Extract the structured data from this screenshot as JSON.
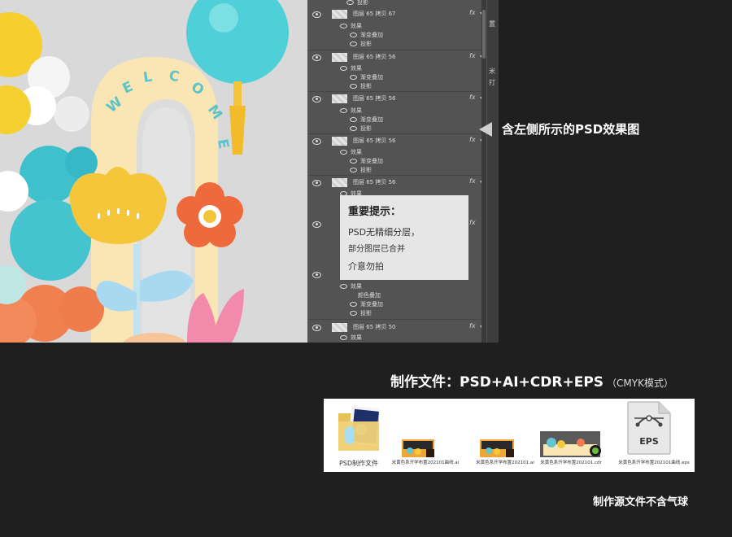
{
  "panel": {
    "layers": [
      {
        "name": "图层 65 拷贝 67",
        "fx": "fx",
        "effects": [
          "效果",
          "渐变叠加",
          "投影"
        ]
      },
      {
        "name": "图层 65 拷贝 56",
        "fx": "fx",
        "effects": [
          "效果",
          "渐变叠加",
          "投影"
        ]
      },
      {
        "name": "图层 65 拷贝 56",
        "fx": "fx",
        "effects": [
          "效果",
          "渐变叠加",
          "投影"
        ]
      },
      {
        "name": "图层 65 拷贝 56",
        "fx": "fx",
        "effects": [
          "效果",
          "渐变叠加",
          "投影"
        ]
      },
      {
        "name": "图层 65 拷贝 56",
        "fx": "fx",
        "effects": [
          "效果"
        ]
      }
    ],
    "lower_effects": [
      "效果",
      "颜色叠加",
      "渐变叠加",
      "投影"
    ],
    "last_layer": {
      "name": "图层 65 拷贝 50",
      "fx": "fx",
      "effects": [
        "效果"
      ]
    },
    "top_partial": "投影",
    "right_strip": [
      "置",
      "米",
      "打"
    ]
  },
  "notice": {
    "title": "重要提示：",
    "line1": "PSD无精细分层，",
    "line2": "部分图层已合并",
    "line3": "介意勿拍"
  },
  "callout": "含左侧所示的PSD效果图",
  "files_heading": "制作文件：PSD+AI+CDR+EPS",
  "files_heading_sub": "（CMYK模式）",
  "files": [
    {
      "label": "PSD制作文件",
      "icon": "folder-icon"
    },
    {
      "label": "米黄色系开学布置202101曲线.ai",
      "icon": "ai-file-icon"
    },
    {
      "label": "米黄色系开学布置202101.ai",
      "icon": "ai-file-icon"
    },
    {
      "label": "米黄色系开学布置202101.cdr",
      "icon": "cdr-file-icon"
    },
    {
      "label": "米黄色系开学布置202101曲线.eps",
      "icon": "eps-file-icon",
      "badge": "EPS"
    }
  ],
  "artwork": {
    "arch_text": "WELCOME"
  },
  "note": "制作源文件不含气球",
  "colors": {
    "background": "#1f1f1f",
    "panel": "#535353",
    "teal": "#3ec3cf",
    "yellow": "#f6c93a",
    "coral": "#f07a4f",
    "cream": "#fbe7b6"
  }
}
